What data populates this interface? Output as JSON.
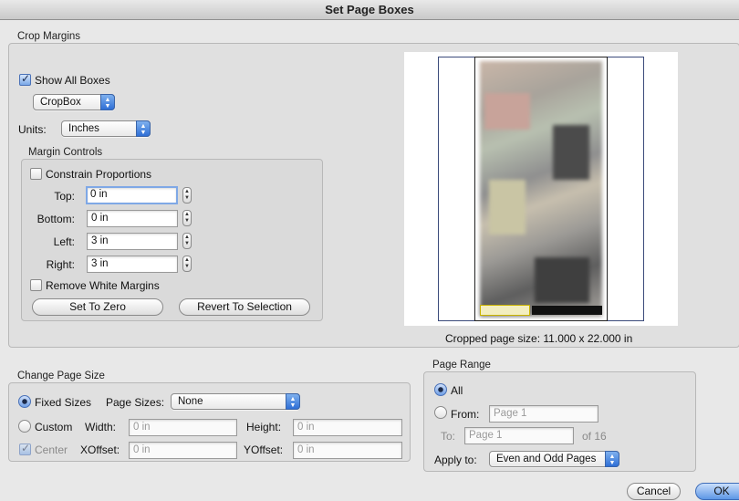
{
  "window": {
    "title": "Set Page Boxes"
  },
  "crop_margins": {
    "section_title": "Crop Margins",
    "show_all_boxes": {
      "label": "Show All Boxes",
      "checked": true
    },
    "box_popup": {
      "value": "CropBox"
    },
    "units": {
      "label": "Units:",
      "value": "Inches"
    },
    "margin_controls": {
      "title": "Margin Controls",
      "constrain_proportions": {
        "label": "Constrain Proportions",
        "checked": false
      },
      "top": {
        "label": "Top:",
        "value": "0 in"
      },
      "bottom": {
        "label": "Bottom:",
        "value": "0 in"
      },
      "left": {
        "label": "Left:",
        "value": "3 in"
      },
      "right": {
        "label": "Right:",
        "value": "3 in"
      },
      "remove_white_margins": {
        "label": "Remove White Margins",
        "checked": false
      },
      "set_to_zero": "Set To Zero",
      "revert_to_selection": "Revert To Selection"
    },
    "cropped_page_size": "Cropped page size: 11.000 x 22.000 in"
  },
  "change_page_size": {
    "section_title": "Change Page Size",
    "fixed_sizes": {
      "label": "Fixed Sizes",
      "selected": true
    },
    "page_sizes": {
      "label": "Page Sizes:",
      "value": "None"
    },
    "custom": {
      "label": "Custom",
      "selected": false
    },
    "width": {
      "label": "Width:",
      "value": "0 in"
    },
    "height": {
      "label": "Height:",
      "value": "0 in"
    },
    "center": {
      "label": "Center",
      "checked": true,
      "disabled": true
    },
    "xoffset": {
      "label": "XOffset:",
      "value": "0 in"
    },
    "yoffset": {
      "label": "YOffset:",
      "value": "0 in"
    }
  },
  "page_range": {
    "section_title": "Page Range",
    "all": {
      "label": "All",
      "selected": true
    },
    "from": {
      "label": "From:",
      "placeholder": "Page 1"
    },
    "to": {
      "label": "To:",
      "placeholder": "Page 1"
    },
    "of_total": "of 16",
    "apply_to": {
      "label": "Apply to:",
      "value": "Even and Odd Pages"
    }
  },
  "buttons": {
    "cancel": "Cancel",
    "ok": "OK"
  }
}
